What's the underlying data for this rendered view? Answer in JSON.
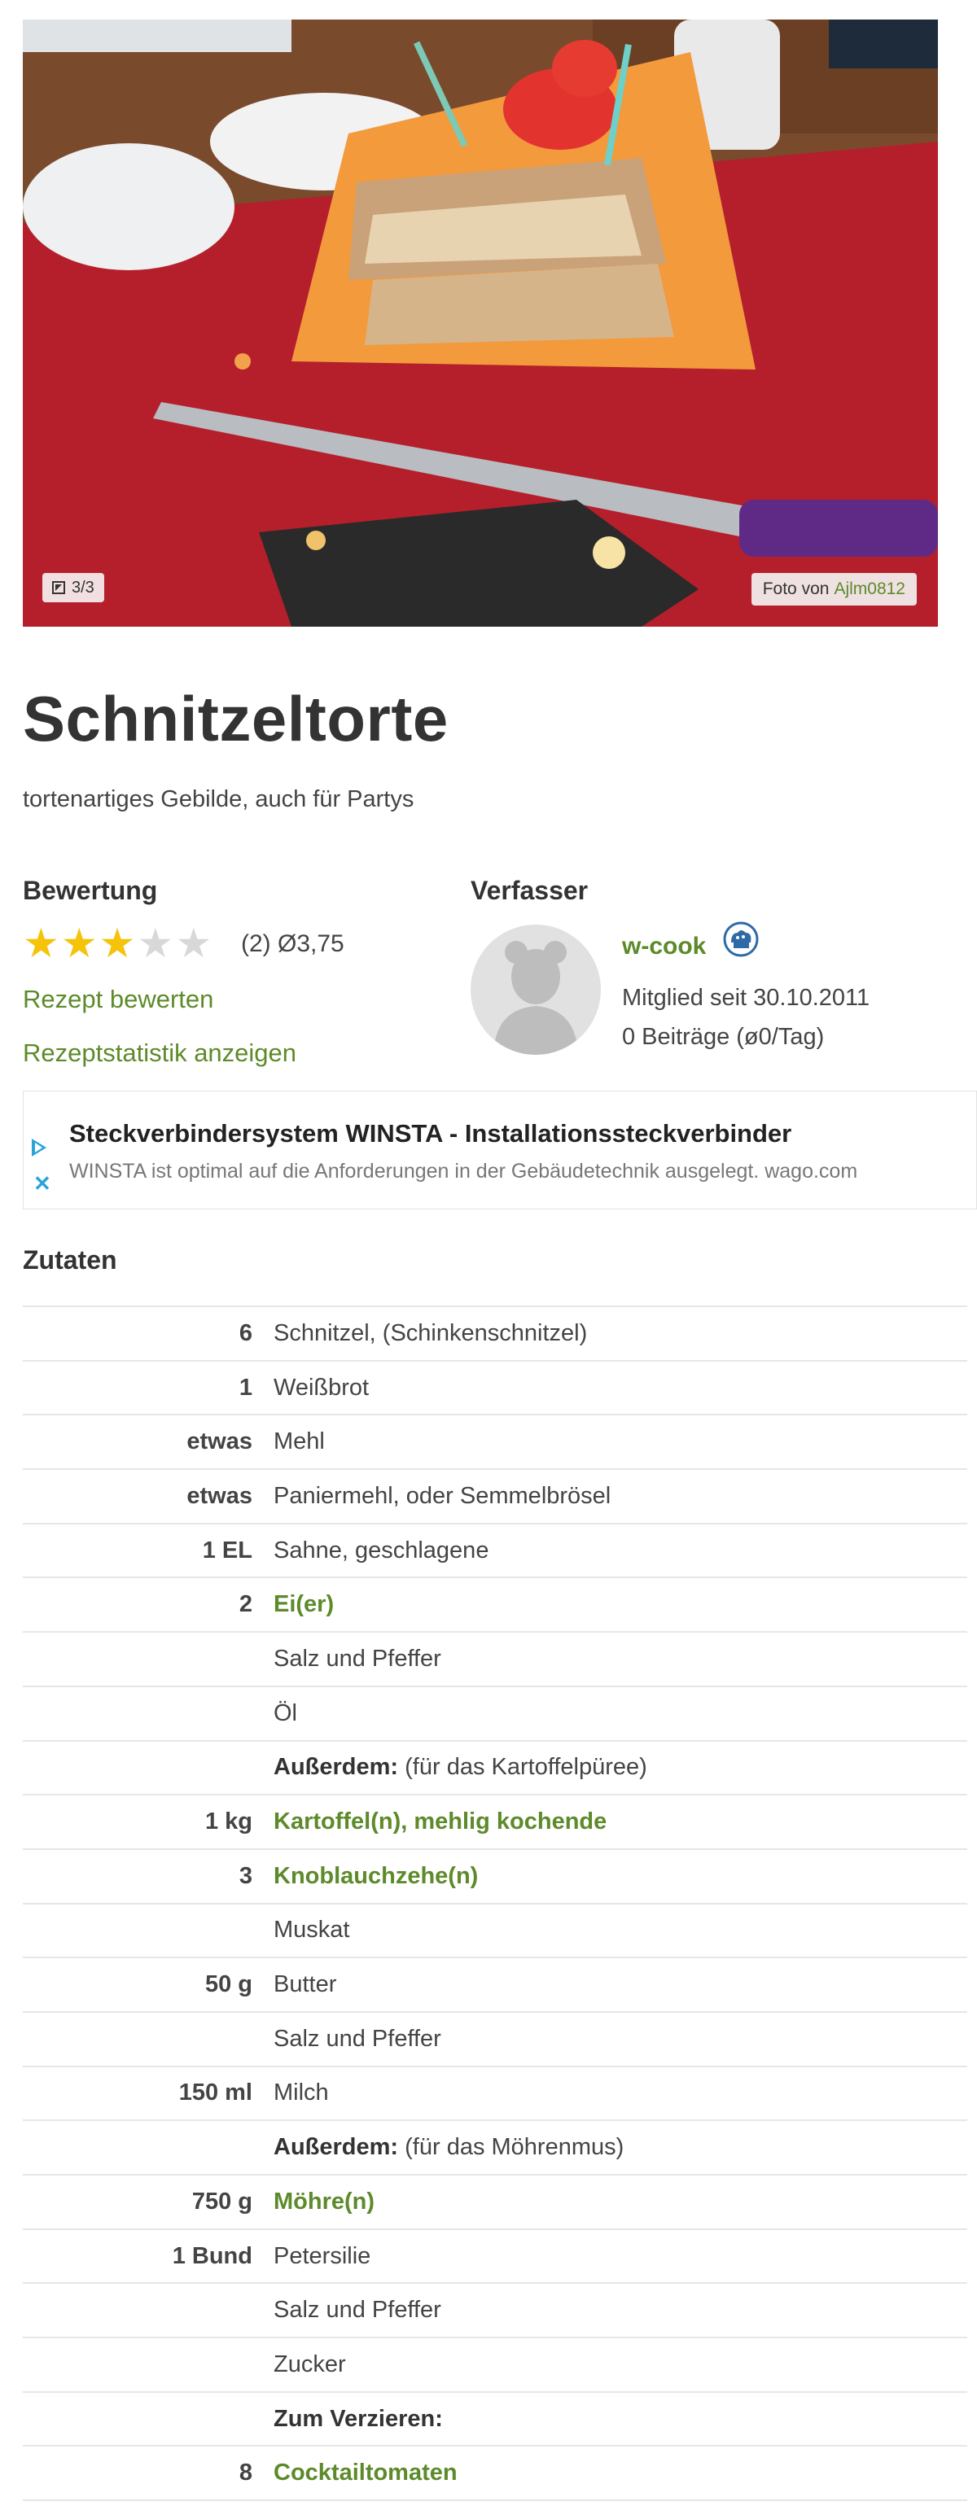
{
  "photo": {
    "counter": "3/3",
    "credit_prefix": "Foto von",
    "credit_author": "Ajlm0812"
  },
  "recipe": {
    "title": "Schnitzeltorte",
    "subtitle": "tortenartiges Gebilde, auch für Partys"
  },
  "rating": {
    "heading": "Bewertung",
    "stars_value": 3.75,
    "stars_max": 5,
    "count_text": "(2)",
    "average_text": "Ø3,75",
    "rate_link": "Rezept bewerten",
    "stats_link": "Rezeptstatistik anzeigen"
  },
  "author": {
    "heading": "Verfasser",
    "name": "w-cook",
    "member_since": "Mitglied seit 30.10.2011",
    "posts": "0 Beiträge (ø0/Tag)",
    "badge_icon": "chef-hat-badge-icon"
  },
  "ad": {
    "title": "Steckverbindersystem WINSTA - Installationssteckverbinder",
    "description": "WINSTA ist optimal auf die Anforderungen in der Gebäudetechnik ausgelegt. wago.com",
    "play_icon": "adchoices-play-icon",
    "close_icon": "ad-close-icon",
    "accent_color": "#29a3d8"
  },
  "ingredients": {
    "heading": "Zutaten",
    "rows": [
      {
        "amount": "6",
        "name": "Schnitzel, (Schinkenschnitzel)",
        "kind": "plain"
      },
      {
        "amount": "1",
        "name": "Weißbrot",
        "kind": "plain"
      },
      {
        "amount": "etwas",
        "name": "Mehl",
        "kind": "plain"
      },
      {
        "amount": "etwas",
        "name": "Paniermehl, oder Semmelbrösel",
        "kind": "plain"
      },
      {
        "amount": "1 EL",
        "name": "Sahne, geschlagene",
        "kind": "plain"
      },
      {
        "amount": "2",
        "name": "Ei(er)",
        "kind": "link"
      },
      {
        "amount": "",
        "name": "Salz und Pfeffer",
        "kind": "plain"
      },
      {
        "amount": "",
        "name": "Öl",
        "kind": "plain"
      },
      {
        "amount": "",
        "name": "Außerdem:",
        "note": " (für das Kartoffelpüree)",
        "kind": "section"
      },
      {
        "amount": "1 kg",
        "name": "Kartoffel(n), mehlig kochende",
        "kind": "link"
      },
      {
        "amount": "3",
        "name": "Knoblauchzehe(n)",
        "kind": "link"
      },
      {
        "amount": "",
        "name": "Muskat",
        "kind": "plain"
      },
      {
        "amount": "50 g",
        "name": "Butter",
        "kind": "plain"
      },
      {
        "amount": "",
        "name": "Salz und Pfeffer",
        "kind": "plain"
      },
      {
        "amount": "150 ml",
        "name": "Milch",
        "kind": "plain"
      },
      {
        "amount": "",
        "name": "Außerdem:",
        "note": " (für das Möhrenmus)",
        "kind": "section"
      },
      {
        "amount": "750 g",
        "name": "Möhre(n)",
        "kind": "link"
      },
      {
        "amount": "1 Bund",
        "name": "Petersilie",
        "kind": "plain"
      },
      {
        "amount": "",
        "name": "Salz und Pfeffer",
        "kind": "plain"
      },
      {
        "amount": "",
        "name": "Zucker",
        "kind": "plain"
      },
      {
        "amount": "",
        "name": "Zum Verzieren:",
        "note": "",
        "kind": "section"
      },
      {
        "amount": "8",
        "name": "Cocktailtomaten",
        "kind": "link"
      }
    ]
  },
  "colors": {
    "link_green": "#5d8a2a",
    "star_gold": "#f4c30a",
    "star_empty": "#d8d8d8",
    "text": "#333333"
  }
}
